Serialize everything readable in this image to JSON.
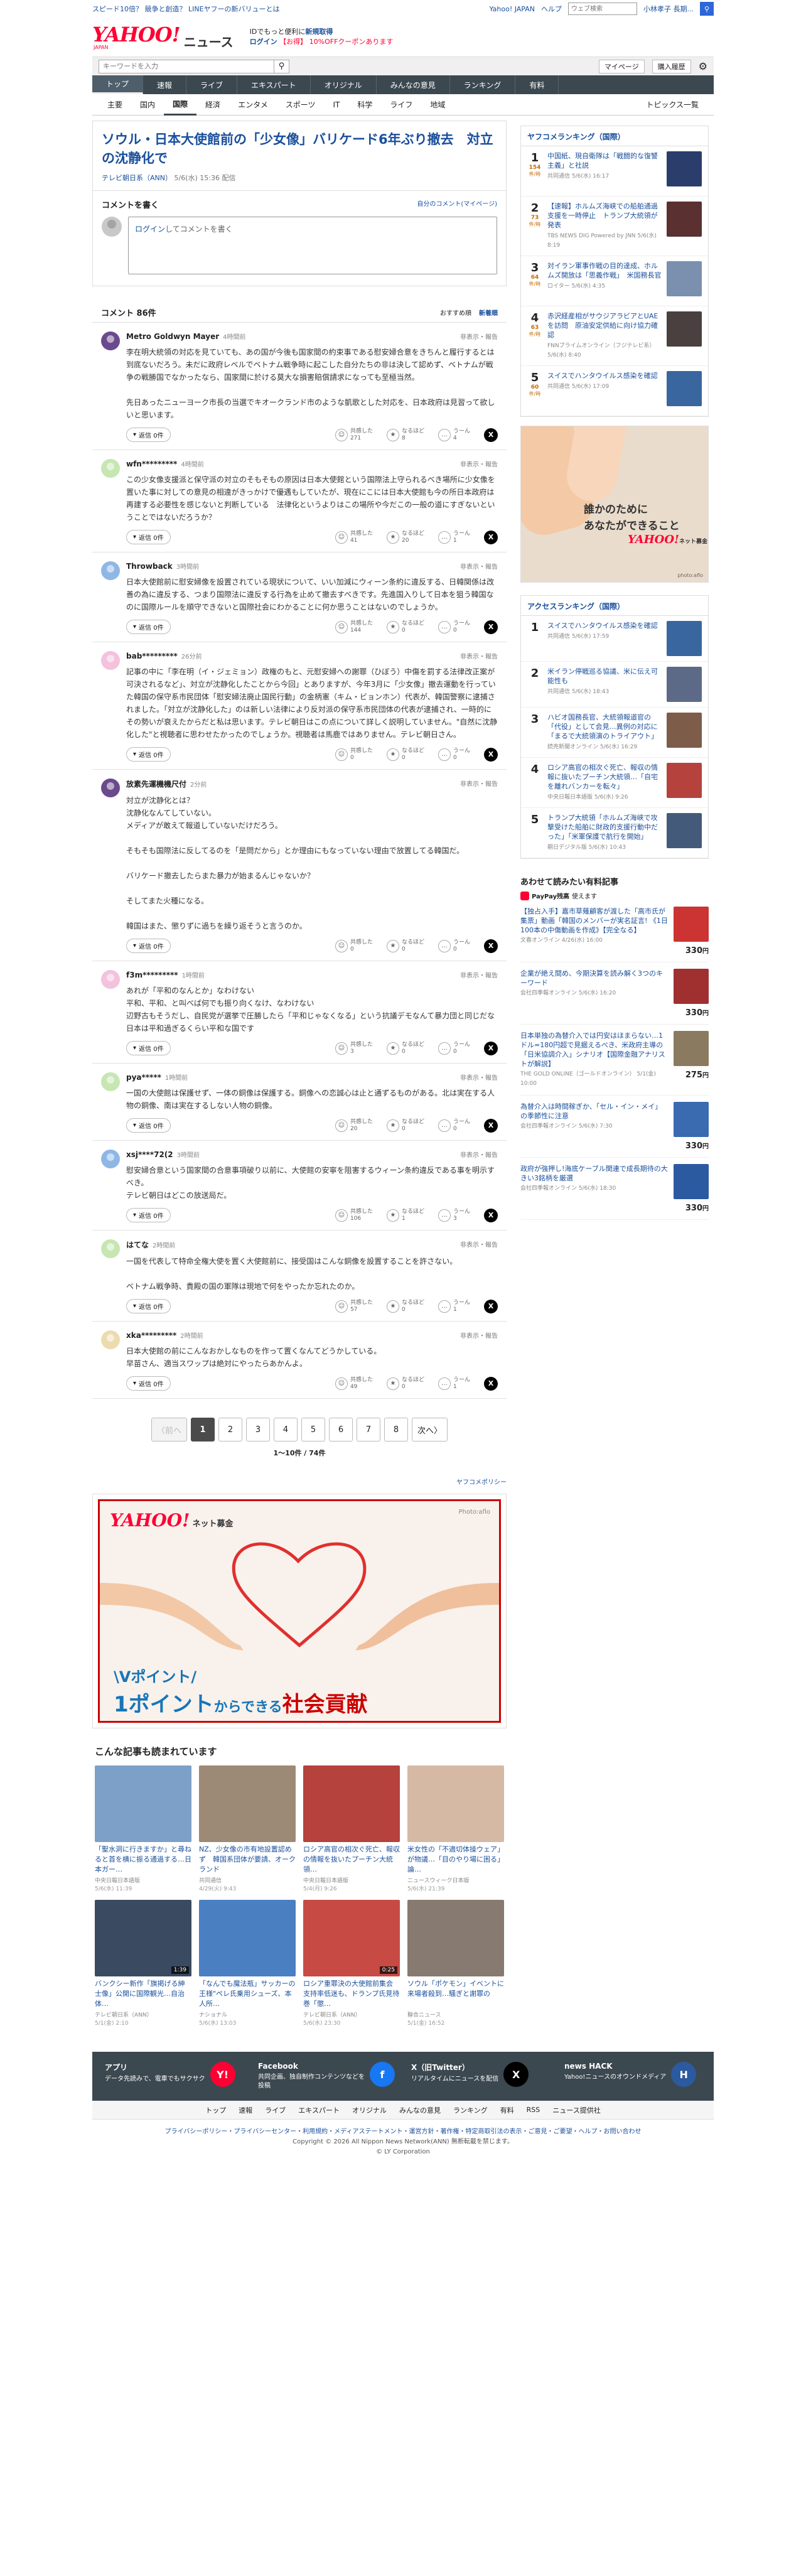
{
  "promo": {
    "left": "スピード10倍？ 競争と創造？ LINEヤフーの新バリューとは",
    "yj": "Yahoo! JAPAN",
    "help": "ヘルプ",
    "search_placeholder": "ウェブ検索",
    "username": "小林孝子 長期..."
  },
  "header": {
    "logo": "YAHOO!",
    "logo_sub": "JAPAN",
    "service": "ニュース",
    "ad_line1": "IDでもっと便利に",
    "ad_line1_link": "新規取得",
    "ad_line2": "ログイン",
    "ad_line3": "【お得】 10%OFFクーポンあります"
  },
  "toolbar": {
    "keyword_placeholder": "キーワードを入力",
    "mypage": "マイページ",
    "subscribe": "購入履歴"
  },
  "gnav": [
    "トップ",
    "速報",
    "ライブ",
    "エキスパート",
    "オリジナル",
    "みんなの意見",
    "ランキング",
    "有料"
  ],
  "subnav": [
    "主要",
    "国内",
    "国際",
    "経済",
    "エンタメ",
    "スポーツ",
    "IT",
    "科学",
    "ライフ",
    "地域"
  ],
  "subnav_topics": "トピックス一覧",
  "article": {
    "title": "ソウル・日本大使館前の「少女像」バリケード6年ぶり撤去　対立の沈静化で",
    "source": "テレビ朝日系（ANN）",
    "date": "5/6(水) 15:36 配信"
  },
  "comment_form": {
    "title": "コメントを書く",
    "mine": "自分のコメント(マイページ)",
    "login": "ログイン",
    "placeholder": "してコメントを書く"
  },
  "comments_header": {
    "title": "コメント 86件",
    "sort_recommend": "おすすめ順",
    "sort_new": "新着順"
  },
  "labels": {
    "report": "非表示・報告",
    "reply": "返信",
    "agree": "共感した",
    "insight": "なるほど",
    "hmm": "うーん",
    "x": "X"
  },
  "comments": [
    {
      "name": "Metro Goldwyn Mayer",
      "time": "4時間前",
      "text": "李在明大統領の対応を見ていても、あの国が今後も国家間の約束事である慰安婦合意をきちんと履行するとは到底ないだろう。未だに政府レベルでベトナム戦争時に起こした自分たちの非は決して認めず、ベトナムが戦争の戦勝国でなかったなら、国家間に於ける莫大な損害賠償請求になっても至極当然。\n\n先日あったニューヨーク市長の当選でキオークランド市のような凱歌とした対応を、日本政府は見習って欲しいと思います。",
      "replies": "返信 0件",
      "agree": "271",
      "insight": "8",
      "hmm": "4",
      "av": "photo"
    },
    {
      "name": "wfn*********",
      "time": "4時間前",
      "text": "この少女像支援派と保守派の対立のそもそもの原因は日本大使館という国際法上守られるべき場所に少女像を置いた事に対しての意見の相違がきっかけで優遇もしていたが、現在にこには日本大使館も今の所日本政府は再建する必要性を感じないと判断している　法律化というよりはこの場所や今だこの一般の道にすぎないということではないだろうか？",
      "replies": "返信 0件",
      "agree": "41",
      "insight": "20",
      "hmm": "1",
      "av": "green"
    },
    {
      "name": "Throwback",
      "time": "3時間前",
      "text": "日本大使館前に慰安婦像を設置されている現状について、いい加減にウィーン条約に違反する、日韓関係は改善の為に違反する、つまり国際法に違反する行為を止めて撤去すべきです。先進国入りして日本を狙う韓国なのに国際ルールを順守できないと国際社会にわかることに何か思うことはないのでしょうか。",
      "replies": "返信 0件",
      "agree": "144",
      "insight": "0",
      "hmm": "0",
      "av": "blue"
    },
    {
      "name": "bab*********",
      "time": "26分前",
      "text": "記事の中に「李在明（イ・ジェミョン）政権のもと、元慰安婦への謝罪（ひぼう）中傷を罰する法律改正案が可決されるなど」、対立が沈静化したことから今回」とありますが、今年3月に「少女像」撤去運動を行っていた韓国の保守系市民団体「慰安婦法廃止国民行動」の金柄憲（キム・ビョンホン）代表が、韓国警察に逮捕されました。「対立が沈静化した」のは新しい法律により反対派の保守系市民団体の代表が逮捕され、一時的にその勢いが衰えたからだと私は思います。テレビ朝日はこの点について詳しく説明していません。\"自然に沈静化した\"と視聴者に思わせたかったのでしょうか。視聴者は馬鹿ではありません。テレビ朝日さん。",
      "replies": "返信 0件",
      "agree": "0",
      "insight": "0",
      "hmm": "0",
      "av": "pink"
    },
    {
      "name": "放素先運機機尺付",
      "time": "2分前",
      "text": "対立が沈静化とは？\n沈静化なんてしていない。\nメディアが敢えて報道していないだけだろう。\n\nそもそも国際法に反してるのを「是問だから」とか理由にもなっていない理由で放置してる韓国だ。\n\nバリケード撤去したらまた暴力が始まるんじゃないか？\n\nそしてまた火種になる。\n\n韓国はまた、懲りずに過ちを繰り返そうと言うのか。",
      "replies": "返信 0件",
      "agree": "0",
      "insight": "0",
      "hmm": "0",
      "av": "photo"
    },
    {
      "name": "f3m*********",
      "time": "1時間前",
      "text": "あれが「平和のなんとか」なわけない\n平和、平和、と叫べば何でも振り向くなけ、なわけない\n辺野古もそうだし、自民党が選挙で圧勝したら「平和じゃなくなる」という抗議デモなんて暴力団と同じだな\n日本は平和過ぎるくらい平和な国です",
      "replies": "返信 0件",
      "agree": "3",
      "insight": "0",
      "hmm": "0",
      "av": "pink"
    },
    {
      "name": "pya*****",
      "time": "1時間前",
      "text": "一国の大使館は保護せず、一体の銅像は保護する。銅像への恋誠心は止と通ずるものがある。北は実在する人物の銅像、南は実在するしない人物の銅像。",
      "replies": "返信 0件",
      "agree": "20",
      "insight": "0",
      "hmm": "0",
      "av": "green"
    },
    {
      "name": "xsj****72(2",
      "time": "3時間前",
      "text": "慰安婦合意という国家間の合意事項破り以前に、大使館の安寧を阻害するウィーン条約違反である事を明示すべき。\nテレビ朝日はどこの放送局だ。",
      "replies": "返信 0件",
      "agree": "106",
      "insight": "1",
      "hmm": "3",
      "av": "blue"
    },
    {
      "name": "はてな",
      "time": "2時間前",
      "text": "一国を代表して特命全権大使を置く大使館前に、接受国はこんな銅像を設置することを許さない。\n\nベトナム戦争時、貴殿の国の軍隊は現地で何をやったか忘れたのか。",
      "replies": "返信 0件",
      "agree": "57",
      "insight": "0",
      "hmm": "1",
      "av": "green"
    },
    {
      "name": "xka*********",
      "time": "2時間前",
      "text": "日本大使館の前にこんなおかしなものを作って置くなんてどうかしている。\n早苗さん、適当スワップは絶対にやったらあかんよ。",
      "replies": "返信 0件",
      "agree": "49",
      "insight": "0",
      "hmm": "1",
      "av": "beige"
    }
  ],
  "pager": {
    "prev": "〈前へ",
    "pages": [
      "1",
      "2",
      "3",
      "4",
      "5",
      "6",
      "7",
      "8"
    ],
    "next": "次へ〉",
    "count": "1〜10件 / 74件"
  },
  "policy": "ヤフコメポリシー",
  "banner": {
    "logo": "YAHOO!",
    "logo_sub": "ネット募金",
    "photo": "Photo:aflo",
    "line1": "\\Vポイント/",
    "line2_a": "1ポイント",
    "line2_b": "からできる",
    "line2_c": "社会貢献"
  },
  "recommended": {
    "title": "こんな記事も読まれています",
    "items": [
      {
        "cap": "「聖水洞に行きますか」と尋ねると首を横に振る通過する…日本ガー…",
        "src": "中央日報日本語版",
        "date": "5/6(水) 11:39",
        "color": "#7da0c8",
        "dur": ""
      },
      {
        "cap": "NZ、少女像の市有地設置認めず　韓国系団体が要請、オークランド",
        "src": "共同通信",
        "date": "4/29(火) 9:43",
        "color": "#9c8a76",
        "dur": ""
      },
      {
        "cap": "ロシア高官の相次ぐ死亡、報収の情報を抜いたプーチン大統領…",
        "src": "中央日報日本語版",
        "date": "5/4(月) 9:26",
        "color": "#b5423c",
        "dur": ""
      },
      {
        "cap": "米女性の「不適切体操ウェア」が物議…「目のやり場に困る」論…",
        "src": "ニュースウィーク日本版",
        "date": "5/6(水) 21:39",
        "color": "#d6b9a4",
        "dur": ""
      },
      {
        "cap": "バンクシー新作「旗掲げる紳士像」公開に国際観光…自治体…",
        "src": "テレビ朝日系（ANN）",
        "date": "5/1(金) 2:10",
        "color": "#3a4a60",
        "dur": "1:39"
      },
      {
        "cap": "「なんでも魔法瓶」サッカーの王様\"ペレ氏乗用シューズ、本人所…",
        "src": "ナショナル",
        "date": "5/6(水) 13:03",
        "color": "#4a7fc2",
        "dur": ""
      },
      {
        "cap": "ロシア重罪決の大使館前集会　支持率低迷も、ドランプ氏見待巻「懲…",
        "src": "テレビ朝日系（ANN）",
        "date": "5/6(水) 23:30",
        "color": "#c84a44",
        "dur": "0:25"
      },
      {
        "cap": "ソウル「ポケモン」イベントに来場者殺到…騒ぎと謝罪の",
        "src": "聯合ニュース",
        "date": "5/1(金) 16:52",
        "color": "#877a70",
        "dur": ""
      }
    ]
  },
  "side_yahoo": {
    "title_a": "ヤフコメランキング",
    "title_b": "（国際）",
    "items": [
      {
        "n": "1",
        "cnt": "154",
        "cntl": "件/時",
        "t": "中国紙、現自衛隊は「戦闘的な復讐主義」と社説",
        "s": "共同通信 5/6(水) 16:17",
        "color": "#2b3e6b"
      },
      {
        "n": "2",
        "cnt": "73",
        "cntl": "件/時",
        "t": "【速報】ホルムズ海峡での船舶通過支援を一時停止　トランプ大統領が発表",
        "s": "TBS NEWS DIG Powered by JNN 5/6(水) 8:19",
        "color": "#5a3030"
      },
      {
        "n": "3",
        "cnt": "64",
        "cntl": "件/時",
        "t": "対イラン軍事作戦の目的達成、ホルムズ開放は「思義作戦」　米国務長官",
        "s": "ロイター 5/6(水) 4:35",
        "color": "#7b8fae"
      },
      {
        "n": "4",
        "cnt": "63",
        "cntl": "件/時",
        "t": "赤沢経産相がサウジアラビアとUAEを訪問　原油安定供給に向け協力確認",
        "s": "FNNプライムオンライン（フジテレビ系） 5/6(水) 8:40",
        "color": "#4a4040"
      },
      {
        "n": "5",
        "cnt": "60",
        "cntl": "件/時",
        "t": "スイスでハンタウイルス感染を確認",
        "s": "共同通信 5/6(水) 17:09",
        "color": "#3a66a0"
      }
    ]
  },
  "side_ad": {
    "line1": "誰かのために",
    "line2": "あなたができること",
    "logo": "YAHOO!",
    "logo_sub": "ネット募金",
    "photo": "photo:aflo"
  },
  "side_access": {
    "title_a": "アクセスランキング",
    "title_b": "（国際）",
    "items": [
      {
        "n": "1",
        "t": "スイスでハンタウイルス感染を確認",
        "s": "共同通信 5/6(水) 17:59",
        "color": "#3a66a0"
      },
      {
        "n": "2",
        "t": "米イラン停戦巡る協議、米に伝え可能性も",
        "s": "共同通信 5/6(水) 18:43",
        "color": "#5c6a88"
      },
      {
        "n": "3",
        "t": "ハビオ国務長官、大統領報道官の「代役」として会見…異例の対応に「まるで大統領演のトライアウト」",
        "s": "読売新聞オンライン 5/6(水) 16:29",
        "color": "#7d5c4a"
      },
      {
        "n": "4",
        "t": "ロシア高官の相次ぐ死亡、報収の情報に抜いたプーチン大統領…「自宅を離れバンカーを転々」",
        "s": "中央日報日本語版 5/6(水) 9:26",
        "color": "#b5423c"
      },
      {
        "n": "5",
        "t": "トランプ大統領「ホルムズ海峡で攻撃受けた船舶に財政的支援行動中だった」「米軍保護で航行を開始」",
        "s": "朝日デジタル版 5/6(水) 10:43",
        "color": "#445a7a"
      }
    ]
  },
  "side_paid": {
    "title": "あわせて読みたい有料記事",
    "sub": "PayPay残高",
    "sub_b": "使えます",
    "items": [
      {
        "t": "【独占入手】嘉市草薙顧客が渡した「高市氏が集票」動画「韓国のメンバーが実名証言! 《1日100本の中傷動画を作成》【完全なる】",
        "s": "文春オンライン 4/26(水) 16:00",
        "price": "330",
        "color": "#cc3333"
      },
      {
        "t": "企業が絶え間め、今期決算を読み解く3つのキーワード",
        "s": "会社四季報オンライン 5/6(水) 16:20",
        "price": "330",
        "color": "#a03030"
      },
      {
        "t": "日本単独の為替介入では円安はほまらない…1ドル=180円超で見据えるべき、米政府主導の「日米協調介入」シナリオ【国際金融アナリストが解説】",
        "s": "THE GOLD ONLINE（ゴールドオンライン） 5/1(金) 10:00",
        "price": "275",
        "color": "#8a7a60"
      },
      {
        "t": "為替介入は時間稼ぎか、「セル・イン・メイ」の季節性に注意",
        "s": "会社四季報オンライン 5/6(水) 7:30",
        "price": "330",
        "color": "#3a6ab0"
      },
      {
        "t": "政府が強押し!海底ケーブル関連で成長期待の大きい3銘柄を厳選",
        "s": "会社四季報オンライン 5/6(水) 18:30",
        "price": "330",
        "color": "#2c5aa0"
      }
    ],
    "yen": "円"
  },
  "footer": {
    "items": [
      {
        "tt": "アプリ",
        "dd": "データ先読みで、電車でもサクサク",
        "ic": "Y!",
        "color": "#ff0033"
      },
      {
        "tt": "Facebook",
        "dd": "共同企画、独自制作コンテンツなどを投稿",
        "ic": "f",
        "color": "#1877f2"
      },
      {
        "tt": "X（旧Twitter）",
        "dd": "リアルタイムにニュースを配信",
        "ic": "X",
        "color": "#000000"
      },
      {
        "tt": "news HACK",
        "dd": "Yahoo!ニュースのオウンドメディア",
        "ic": "H",
        "color": "#2c5aa0"
      }
    ],
    "nav": [
      "トップ",
      "速報",
      "ライブ",
      "エキスパート",
      "オリジナル",
      "みんなの意見",
      "ランキング",
      "有料",
      "RSS",
      "ニュース提供社"
    ],
    "links": "プライバシーポリシー・プライバシーセンター・利用規約・メディアステートメント・運営方針・著作権・特定商取引法の表示・ご意見・ご要望・ヘルプ・お問い合わせ",
    "copy": "Copyright © 2026 All Nippon News Network(ANN) 無断転載を禁じます。",
    "copy2": "© LY Corporation"
  }
}
